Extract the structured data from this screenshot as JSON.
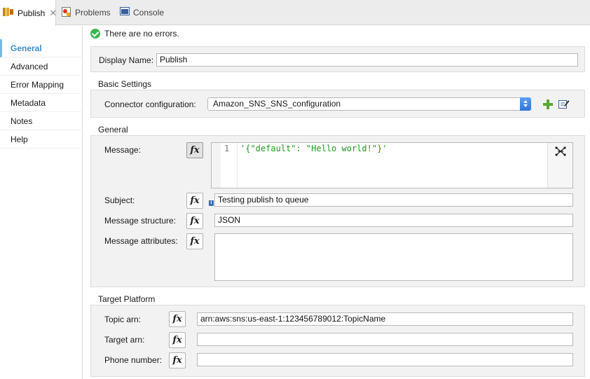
{
  "tabs": [
    {
      "label": "Publish",
      "icon": "publish-connector-icon",
      "active": true
    },
    {
      "label": "Problems",
      "icon": "problems-icon",
      "active": false
    },
    {
      "label": "Console",
      "icon": "console-icon",
      "active": false
    }
  ],
  "sidebar": {
    "items": [
      {
        "label": "General"
      },
      {
        "label": "Advanced"
      },
      {
        "label": "Error Mapping"
      },
      {
        "label": "Metadata"
      },
      {
        "label": "Notes"
      },
      {
        "label": "Help"
      }
    ]
  },
  "status": {
    "text": "There are no errors."
  },
  "display": {
    "label": "Display Name:",
    "value": "Publish"
  },
  "basic": {
    "title": "Basic Settings",
    "connector_label": "Connector configuration:",
    "connector_value": "Amazon_SNS_SNS_configuration"
  },
  "general": {
    "title": "General",
    "message_label": "Message:",
    "line_number": "1",
    "code": "'{\"default\": \"Hello world!\"}'",
    "subject_label": "Subject:",
    "subject_value": "Testing publish to queue",
    "structure_label": "Message structure:",
    "structure_value": "JSON",
    "attributes_label": "Message attributes:"
  },
  "target": {
    "title": "Target Platform",
    "topic_label": "Topic arn:",
    "topic_value": "arn:aws:sns:us-east-1:123456789012:TopicName",
    "target_label": "Target arn:",
    "target_value": "",
    "phone_label": "Phone number:",
    "phone_value": ""
  },
  "fx_label": "fx",
  "info_badge": "i",
  "colors": {
    "accent": "#3d8fc9",
    "success": "#3bb54a",
    "select": "#2d74d9",
    "code": "#1e9a1e"
  }
}
